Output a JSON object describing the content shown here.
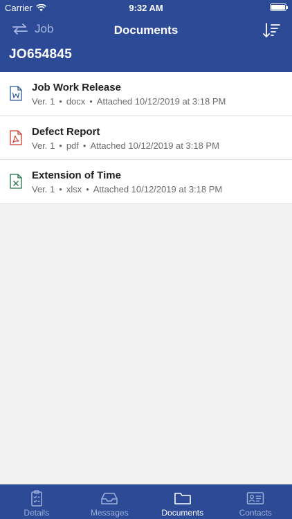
{
  "status_bar": {
    "carrier": "Carrier",
    "time": "9:32 AM"
  },
  "nav": {
    "back_label": "Job",
    "title": "Documents"
  },
  "job": {
    "id": "JO654845"
  },
  "documents": [
    {
      "title": "Job Work Release",
      "version": "Ver. 1",
      "type": "docx",
      "attached": "Attached 10/12/2019 at 3:18 PM",
      "icon": "word-file-icon"
    },
    {
      "title": "Defect Report",
      "version": "Ver. 1",
      "type": "pdf",
      "attached": "Attached 10/12/2019 at 3:18 PM",
      "icon": "pdf-file-icon"
    },
    {
      "title": "Extension of Time",
      "version": "Ver. 1",
      "type": "xlsx",
      "attached": "Attached 10/12/2019 at 3:18 PM",
      "icon": "excel-file-icon"
    }
  ],
  "tabs": [
    {
      "label": "Details",
      "icon": "clipboard-checklist-icon"
    },
    {
      "label": "Messages",
      "icon": "inbox-tray-icon"
    },
    {
      "label": "Documents",
      "icon": "folder-icon",
      "active": true
    },
    {
      "label": "Contacts",
      "icon": "contact-card-icon"
    }
  ],
  "colors": {
    "primary": "#2d4a96",
    "word": "#2b5797",
    "pdf": "#d13b2c",
    "excel": "#207245"
  },
  "separator": "•"
}
